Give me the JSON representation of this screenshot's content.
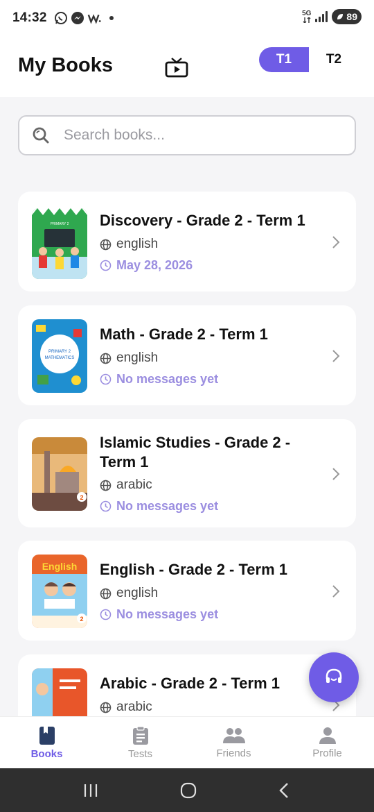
{
  "status_bar": {
    "time": "14:32",
    "network": "5G",
    "battery": "89"
  },
  "header": {
    "title": "My Books",
    "tv_icon": "tv-play-icon",
    "terms": [
      {
        "label": "T1",
        "active": true
      },
      {
        "label": "T2",
        "active": false
      }
    ]
  },
  "search": {
    "placeholder": "Search books...",
    "value": ""
  },
  "books": [
    {
      "title": "Discovery - Grade 2 - Term 1",
      "language": "english",
      "status": "May 28, 2026",
      "cover_color": "#2fa84f"
    },
    {
      "title": "Math - Grade 2 - Term 1",
      "language": "english",
      "status": "No messages yet",
      "cover_color": "#1f8fd0"
    },
    {
      "title": "Islamic Studies - Grade 2 - Term 1",
      "language": "arabic",
      "status": "No messages yet",
      "cover_color": "#c98a3a"
    },
    {
      "title": "English - Grade 2 - Term 1",
      "language": "english",
      "status": "No messages yet",
      "cover_color": "#e9652a"
    },
    {
      "title": "Arabic - Grade 2 - Term 1",
      "language": "arabic",
      "status": "",
      "cover_color": "#e8562a"
    }
  ],
  "bottom_nav": [
    {
      "label": "Books",
      "icon": "book-icon",
      "active": true
    },
    {
      "label": "Tests",
      "icon": "clipboard-icon",
      "active": false
    },
    {
      "label": "Friends",
      "icon": "friends-icon",
      "active": false
    },
    {
      "label": "Profile",
      "icon": "profile-icon",
      "active": false
    }
  ],
  "colors": {
    "accent": "#6f5ce6",
    "date_text": "#9b8ee0"
  }
}
